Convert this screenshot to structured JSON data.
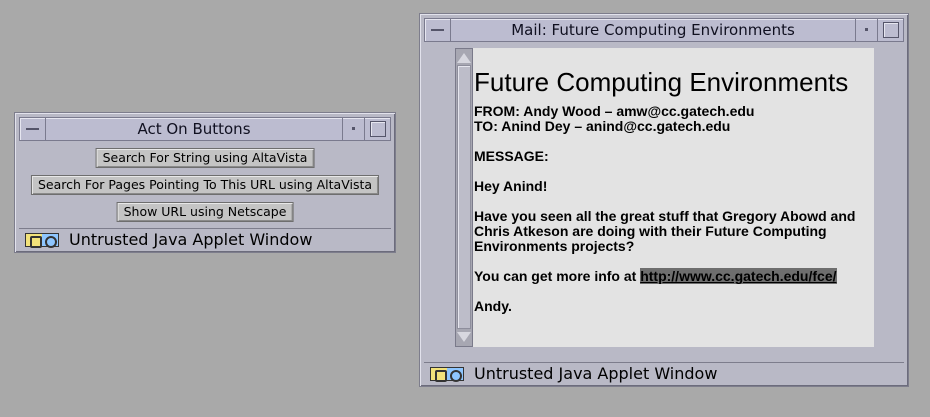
{
  "act_window": {
    "title": "Act On Buttons",
    "buttons": [
      "Search For String using AltaVista",
      "Search For Pages Pointing To This URL using AltaVista",
      "Show URL using Netscape"
    ],
    "status_text": "Untrusted Java Applet Window"
  },
  "mail_window": {
    "title": "Mail: Future Computing Environments",
    "heading": "Future Computing Environments",
    "from_line": "FROM: Andy Wood – amw@cc.gatech.edu",
    "to_line": "TO: Anind Dey – anind@cc.gatech.edu",
    "message_label": "MESSAGE:",
    "greeting": "Hey Anind!",
    "body": "Have you seen all the great stuff that Gregory Abowd and Chris Atkeson are doing with their Future Computing Environments projects?",
    "more_info_prefix": "You can get more info at",
    "link": "http://www.cc.gatech.edu/fce/",
    "signature": "Andy.",
    "status_text": "Untrusted Java Applet Window"
  },
  "colors": {
    "desktop": "#a9a9a9",
    "window_frame": "#b9b9c6",
    "content_bg": "#e3e3e3",
    "link_highlight": "#6e6e6e"
  },
  "icons": [
    "window-menu-icon",
    "minimize-icon",
    "maximize-icon",
    "java-applet-icon"
  ]
}
